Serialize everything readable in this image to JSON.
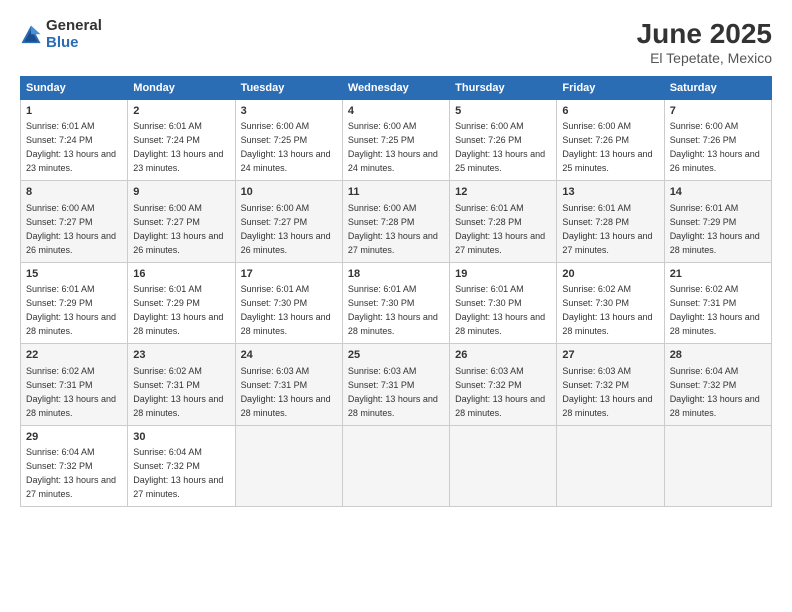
{
  "logo": {
    "general": "General",
    "blue": "Blue"
  },
  "title": {
    "month": "June 2025",
    "location": "El Tepetate, Mexico"
  },
  "headers": [
    "Sunday",
    "Monday",
    "Tuesday",
    "Wednesday",
    "Thursday",
    "Friday",
    "Saturday"
  ],
  "weeks": [
    [
      {
        "day": "1",
        "sunrise": "Sunrise: 6:01 AM",
        "sunset": "Sunset: 7:24 PM",
        "daylight": "Daylight: 13 hours and 23 minutes."
      },
      {
        "day": "2",
        "sunrise": "Sunrise: 6:01 AM",
        "sunset": "Sunset: 7:24 PM",
        "daylight": "Daylight: 13 hours and 23 minutes."
      },
      {
        "day": "3",
        "sunrise": "Sunrise: 6:00 AM",
        "sunset": "Sunset: 7:25 PM",
        "daylight": "Daylight: 13 hours and 24 minutes."
      },
      {
        "day": "4",
        "sunrise": "Sunrise: 6:00 AM",
        "sunset": "Sunset: 7:25 PM",
        "daylight": "Daylight: 13 hours and 24 minutes."
      },
      {
        "day": "5",
        "sunrise": "Sunrise: 6:00 AM",
        "sunset": "Sunset: 7:26 PM",
        "daylight": "Daylight: 13 hours and 25 minutes."
      },
      {
        "day": "6",
        "sunrise": "Sunrise: 6:00 AM",
        "sunset": "Sunset: 7:26 PM",
        "daylight": "Daylight: 13 hours and 25 minutes."
      },
      {
        "day": "7",
        "sunrise": "Sunrise: 6:00 AM",
        "sunset": "Sunset: 7:26 PM",
        "daylight": "Daylight: 13 hours and 26 minutes."
      }
    ],
    [
      {
        "day": "8",
        "sunrise": "Sunrise: 6:00 AM",
        "sunset": "Sunset: 7:27 PM",
        "daylight": "Daylight: 13 hours and 26 minutes."
      },
      {
        "day": "9",
        "sunrise": "Sunrise: 6:00 AM",
        "sunset": "Sunset: 7:27 PM",
        "daylight": "Daylight: 13 hours and 26 minutes."
      },
      {
        "day": "10",
        "sunrise": "Sunrise: 6:00 AM",
        "sunset": "Sunset: 7:27 PM",
        "daylight": "Daylight: 13 hours and 26 minutes."
      },
      {
        "day": "11",
        "sunrise": "Sunrise: 6:00 AM",
        "sunset": "Sunset: 7:28 PM",
        "daylight": "Daylight: 13 hours and 27 minutes."
      },
      {
        "day": "12",
        "sunrise": "Sunrise: 6:01 AM",
        "sunset": "Sunset: 7:28 PM",
        "daylight": "Daylight: 13 hours and 27 minutes."
      },
      {
        "day": "13",
        "sunrise": "Sunrise: 6:01 AM",
        "sunset": "Sunset: 7:28 PM",
        "daylight": "Daylight: 13 hours and 27 minutes."
      },
      {
        "day": "14",
        "sunrise": "Sunrise: 6:01 AM",
        "sunset": "Sunset: 7:29 PM",
        "daylight": "Daylight: 13 hours and 28 minutes."
      }
    ],
    [
      {
        "day": "15",
        "sunrise": "Sunrise: 6:01 AM",
        "sunset": "Sunset: 7:29 PM",
        "daylight": "Daylight: 13 hours and 28 minutes."
      },
      {
        "day": "16",
        "sunrise": "Sunrise: 6:01 AM",
        "sunset": "Sunset: 7:29 PM",
        "daylight": "Daylight: 13 hours and 28 minutes."
      },
      {
        "day": "17",
        "sunrise": "Sunrise: 6:01 AM",
        "sunset": "Sunset: 7:30 PM",
        "daylight": "Daylight: 13 hours and 28 minutes."
      },
      {
        "day": "18",
        "sunrise": "Sunrise: 6:01 AM",
        "sunset": "Sunset: 7:30 PM",
        "daylight": "Daylight: 13 hours and 28 minutes."
      },
      {
        "day": "19",
        "sunrise": "Sunrise: 6:01 AM",
        "sunset": "Sunset: 7:30 PM",
        "daylight": "Daylight: 13 hours and 28 minutes."
      },
      {
        "day": "20",
        "sunrise": "Sunrise: 6:02 AM",
        "sunset": "Sunset: 7:30 PM",
        "daylight": "Daylight: 13 hours and 28 minutes."
      },
      {
        "day": "21",
        "sunrise": "Sunrise: 6:02 AM",
        "sunset": "Sunset: 7:31 PM",
        "daylight": "Daylight: 13 hours and 28 minutes."
      }
    ],
    [
      {
        "day": "22",
        "sunrise": "Sunrise: 6:02 AM",
        "sunset": "Sunset: 7:31 PM",
        "daylight": "Daylight: 13 hours and 28 minutes."
      },
      {
        "day": "23",
        "sunrise": "Sunrise: 6:02 AM",
        "sunset": "Sunset: 7:31 PM",
        "daylight": "Daylight: 13 hours and 28 minutes."
      },
      {
        "day": "24",
        "sunrise": "Sunrise: 6:03 AM",
        "sunset": "Sunset: 7:31 PM",
        "daylight": "Daylight: 13 hours and 28 minutes."
      },
      {
        "day": "25",
        "sunrise": "Sunrise: 6:03 AM",
        "sunset": "Sunset: 7:31 PM",
        "daylight": "Daylight: 13 hours and 28 minutes."
      },
      {
        "day": "26",
        "sunrise": "Sunrise: 6:03 AM",
        "sunset": "Sunset: 7:32 PM",
        "daylight": "Daylight: 13 hours and 28 minutes."
      },
      {
        "day": "27",
        "sunrise": "Sunrise: 6:03 AM",
        "sunset": "Sunset: 7:32 PM",
        "daylight": "Daylight: 13 hours and 28 minutes."
      },
      {
        "day": "28",
        "sunrise": "Sunrise: 6:04 AM",
        "sunset": "Sunset: 7:32 PM",
        "daylight": "Daylight: 13 hours and 28 minutes."
      }
    ],
    [
      {
        "day": "29",
        "sunrise": "Sunrise: 6:04 AM",
        "sunset": "Sunset: 7:32 PM",
        "daylight": "Daylight: 13 hours and 27 minutes."
      },
      {
        "day": "30",
        "sunrise": "Sunrise: 6:04 AM",
        "sunset": "Sunset: 7:32 PM",
        "daylight": "Daylight: 13 hours and 27 minutes."
      },
      {
        "day": "",
        "sunrise": "",
        "sunset": "",
        "daylight": ""
      },
      {
        "day": "",
        "sunrise": "",
        "sunset": "",
        "daylight": ""
      },
      {
        "day": "",
        "sunrise": "",
        "sunset": "",
        "daylight": ""
      },
      {
        "day": "",
        "sunrise": "",
        "sunset": "",
        "daylight": ""
      },
      {
        "day": "",
        "sunrise": "",
        "sunset": "",
        "daylight": ""
      }
    ]
  ]
}
